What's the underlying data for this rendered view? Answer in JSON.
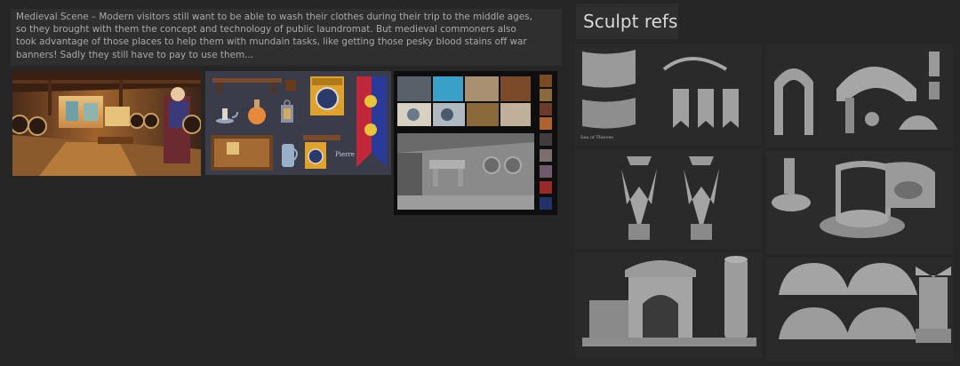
{
  "note": {
    "lines": [
      "Medieval Scene – Modern visitors still want to be able to wash their clothes during their trip to the middle ages,",
      "so they brought with them the concept and technology of public laundromat. But medieval commoners also",
      "took advantage of those places to help them with mundain tasks, like getting those pesky blood stains off war",
      " banners! Sadly they still have to pay to use them..."
    ]
  },
  "sculpt_title": "Sculpt refs",
  "sheet_signature": "Pierre",
  "thumb_sign": "Sea of Thieves",
  "palette": [
    "#7a4a22",
    "#8a6a3c",
    "#6b3b2a",
    "#b0622c",
    "#403c3b",
    "#7a6e6e",
    "#6e5a6a",
    "#9a2a2a",
    "#24306a"
  ],
  "icons": [
    "laundry-machine-icon",
    "banner-icon",
    "lantern-icon",
    "potion-bottle-icon",
    "candle-icon",
    "jug-icon",
    "shelf-icon"
  ]
}
